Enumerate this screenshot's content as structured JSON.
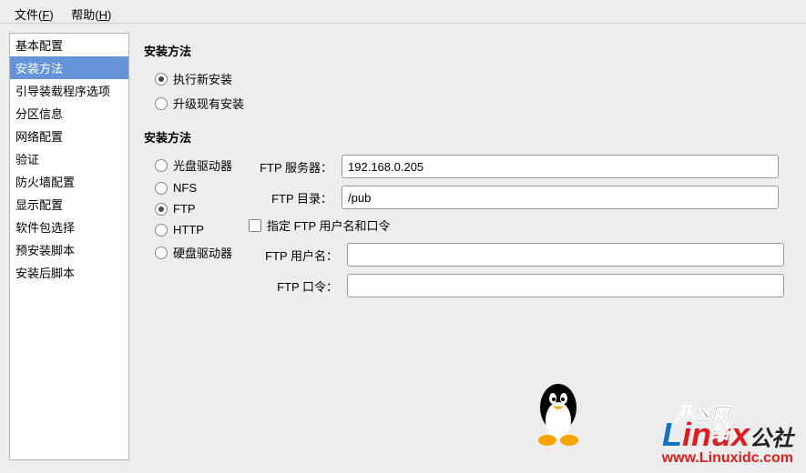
{
  "menubar": {
    "file": {
      "label": "文件",
      "accel": "F"
    },
    "help": {
      "label": "帮助",
      "accel": "H"
    }
  },
  "sidebar": {
    "items": [
      {
        "label": "基本配置",
        "selected": false
      },
      {
        "label": "安装方法",
        "selected": true
      },
      {
        "label": "引导装载程序选项",
        "selected": false
      },
      {
        "label": "分区信息",
        "selected": false
      },
      {
        "label": "网络配置",
        "selected": false
      },
      {
        "label": "验证",
        "selected": false
      },
      {
        "label": "防火墙配置",
        "selected": false
      },
      {
        "label": "显示配置",
        "selected": false
      },
      {
        "label": "软件包选择",
        "selected": false
      },
      {
        "label": "预安装脚本",
        "selected": false
      },
      {
        "label": "安装后脚本",
        "selected": false
      }
    ]
  },
  "install_method": {
    "title": "安装方法",
    "options": [
      {
        "label": "执行新安装",
        "checked": true
      },
      {
        "label": "升级现有安装",
        "checked": false
      }
    ]
  },
  "install_source": {
    "title": "安装方法",
    "options": [
      {
        "label": "光盘驱动器",
        "checked": false
      },
      {
        "label": "NFS",
        "checked": false
      },
      {
        "label": "FTP",
        "checked": true
      },
      {
        "label": "HTTP",
        "checked": false
      },
      {
        "label": "硬盘驱动器",
        "checked": false
      }
    ]
  },
  "ftp": {
    "server_label": "FTP 服务器：",
    "server_value": "192.168.0.205",
    "dir_label": "FTP 目录：",
    "dir_value": "/pub",
    "auth_label": "指定 FTP 用户名和口令",
    "auth_checked": false,
    "user_label": "FTP 用户名：",
    "user_value": "",
    "pass_label": "FTP 口令：",
    "pass_value": ""
  },
  "watermark": {
    "brand_linux": "Linux",
    "brand_cn": "公社",
    "overlay": "黑区网络",
    "url": "www.Linuxidc.com"
  }
}
